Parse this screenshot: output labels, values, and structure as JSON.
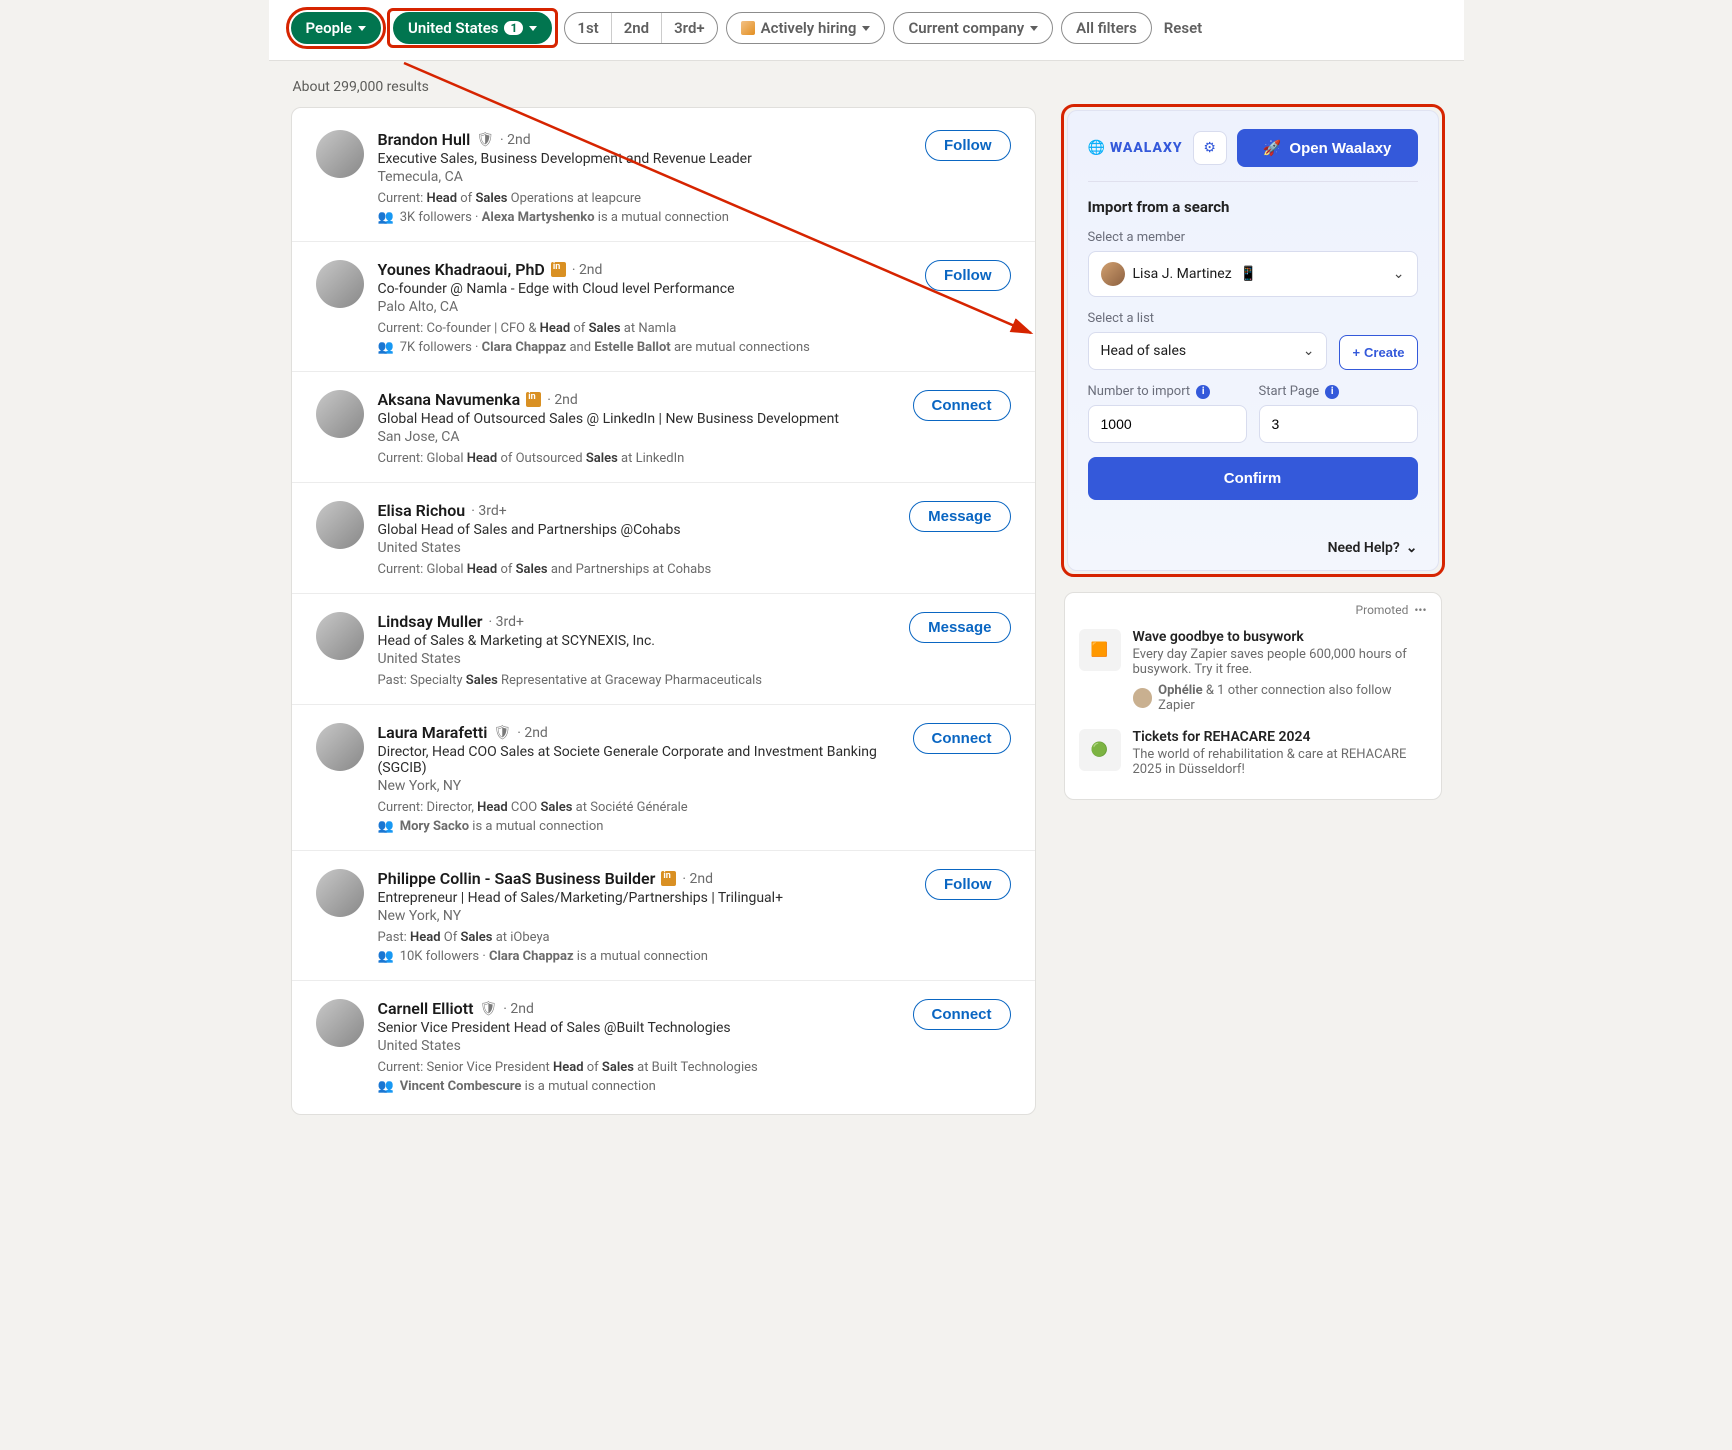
{
  "filters": {
    "people": "People",
    "location": "United States",
    "location_count": "1",
    "conn1": "1st",
    "conn2": "2nd",
    "conn3": "3rd+",
    "hiring": "Actively hiring",
    "company": "Current company",
    "all": "All filters",
    "reset": "Reset"
  },
  "results_count": "About 299,000 results",
  "people": [
    {
      "name": "Brandon Hull",
      "shield": true,
      "degree": "2nd",
      "headline": "Executive Sales, Business Development and Revenue Leader",
      "loc": "Temecula, CA",
      "sub": "Current: <b>Head</b> of <b>Sales</b> Operations at leapcure",
      "mutual": "3K followers · <b>Alexa Martyshenko</b> is a mutual connection",
      "action": "Follow"
    },
    {
      "name": "Younes Khadraoui, PhD",
      "in": true,
      "degree": "2nd",
      "headline": "Co-founder @ Namla - Edge with Cloud level Performance",
      "loc": "Palo Alto, CA",
      "sub": "Current: Co-founder | CFO & <b>Head</b> of <b>Sales</b> at Namla",
      "mutual": "7K followers · <b>Clara Chappaz</b> and <b>Estelle Ballot</b> are mutual connections",
      "action": "Follow"
    },
    {
      "name": "Aksana Navumenka",
      "in": true,
      "degree": "2nd",
      "headline": "Global Head of Outsourced Sales @ LinkedIn | New Business Development",
      "loc": "San Jose, CA",
      "sub": "Current: Global <b>Head</b> of Outsourced <b>Sales</b> at LinkedIn",
      "action": "Connect"
    },
    {
      "name": "Elisa Richou",
      "degree": "3rd+",
      "headline": "Global Head of Sales and Partnerships @Cohabs",
      "loc": "United States",
      "sub": "Current: Global <b>Head</b> of <b>Sales</b> and Partnerships at Cohabs",
      "action": "Message"
    },
    {
      "name": "Lindsay Muller",
      "degree": "3rd+",
      "headline": "Head of Sales & Marketing at SCYNEXIS, Inc.",
      "loc": "United States",
      "sub": "Past: Specialty <b>Sales</b> Representative at Graceway Pharmaceuticals",
      "action": "Message"
    },
    {
      "name": "Laura Marafetti",
      "shield": true,
      "degree": "2nd",
      "headline": "Director, Head COO Sales at Societe Generale Corporate and Investment Banking (SGCIB)",
      "loc": "New York, NY",
      "sub": "Current: Director, <b>Head</b> COO <b>Sales</b> at Société Générale",
      "mutual": "<b>Mory Sacko</b> is a mutual connection",
      "action": "Connect"
    },
    {
      "name": "Philippe Collin - SaaS Business Builder",
      "in": true,
      "degree": "2nd",
      "headline": "Entrepreneur | Head of Sales/Marketing/Partnerships | Trilingual+",
      "loc": "New York, NY",
      "sub": "Past: <b>Head</b> Of <b>Sales</b> at iObeya",
      "mutual": "10K followers · <b>Clara Chappaz</b> is a mutual connection",
      "action": "Follow"
    },
    {
      "name": "Carnell Elliott",
      "shield": true,
      "degree": "2nd",
      "headline": "Senior Vice President Head of Sales @Built Technologies",
      "loc": "United States",
      "sub": "Current: Senior Vice President <b>Head</b> of <b>Sales</b> at Built Technologies",
      "mutual": "<b>Vincent Combescure</b> is a mutual connection",
      "action": "Connect"
    }
  ],
  "waalaxy": {
    "brand": "WAALAXY",
    "open": "Open Waalaxy",
    "title": "Import from a search",
    "member_label": "Select a member",
    "member_value": "Lisa J. Martinez",
    "list_label": "Select a list",
    "list_value": "Head of sales",
    "create": "Create",
    "number_label": "Number to import",
    "number_value": "1000",
    "page_label": "Start Page",
    "page_value": "3",
    "confirm": "Confirm",
    "help": "Need Help?"
  },
  "promoted": {
    "label": "Promoted",
    "items": [
      {
        "title": "Wave goodbye to busywork",
        "desc": "Every day Zapier saves people 600,000 hours of busywork. Try it free.",
        "follow": "<b>Ophélie</b> & 1 other connection also follow Zapier"
      },
      {
        "title": "Tickets for REHACARE 2024",
        "desc": "The world of rehabilitation & care at REHACARE 2025 in Düsseldorf!"
      }
    ]
  }
}
